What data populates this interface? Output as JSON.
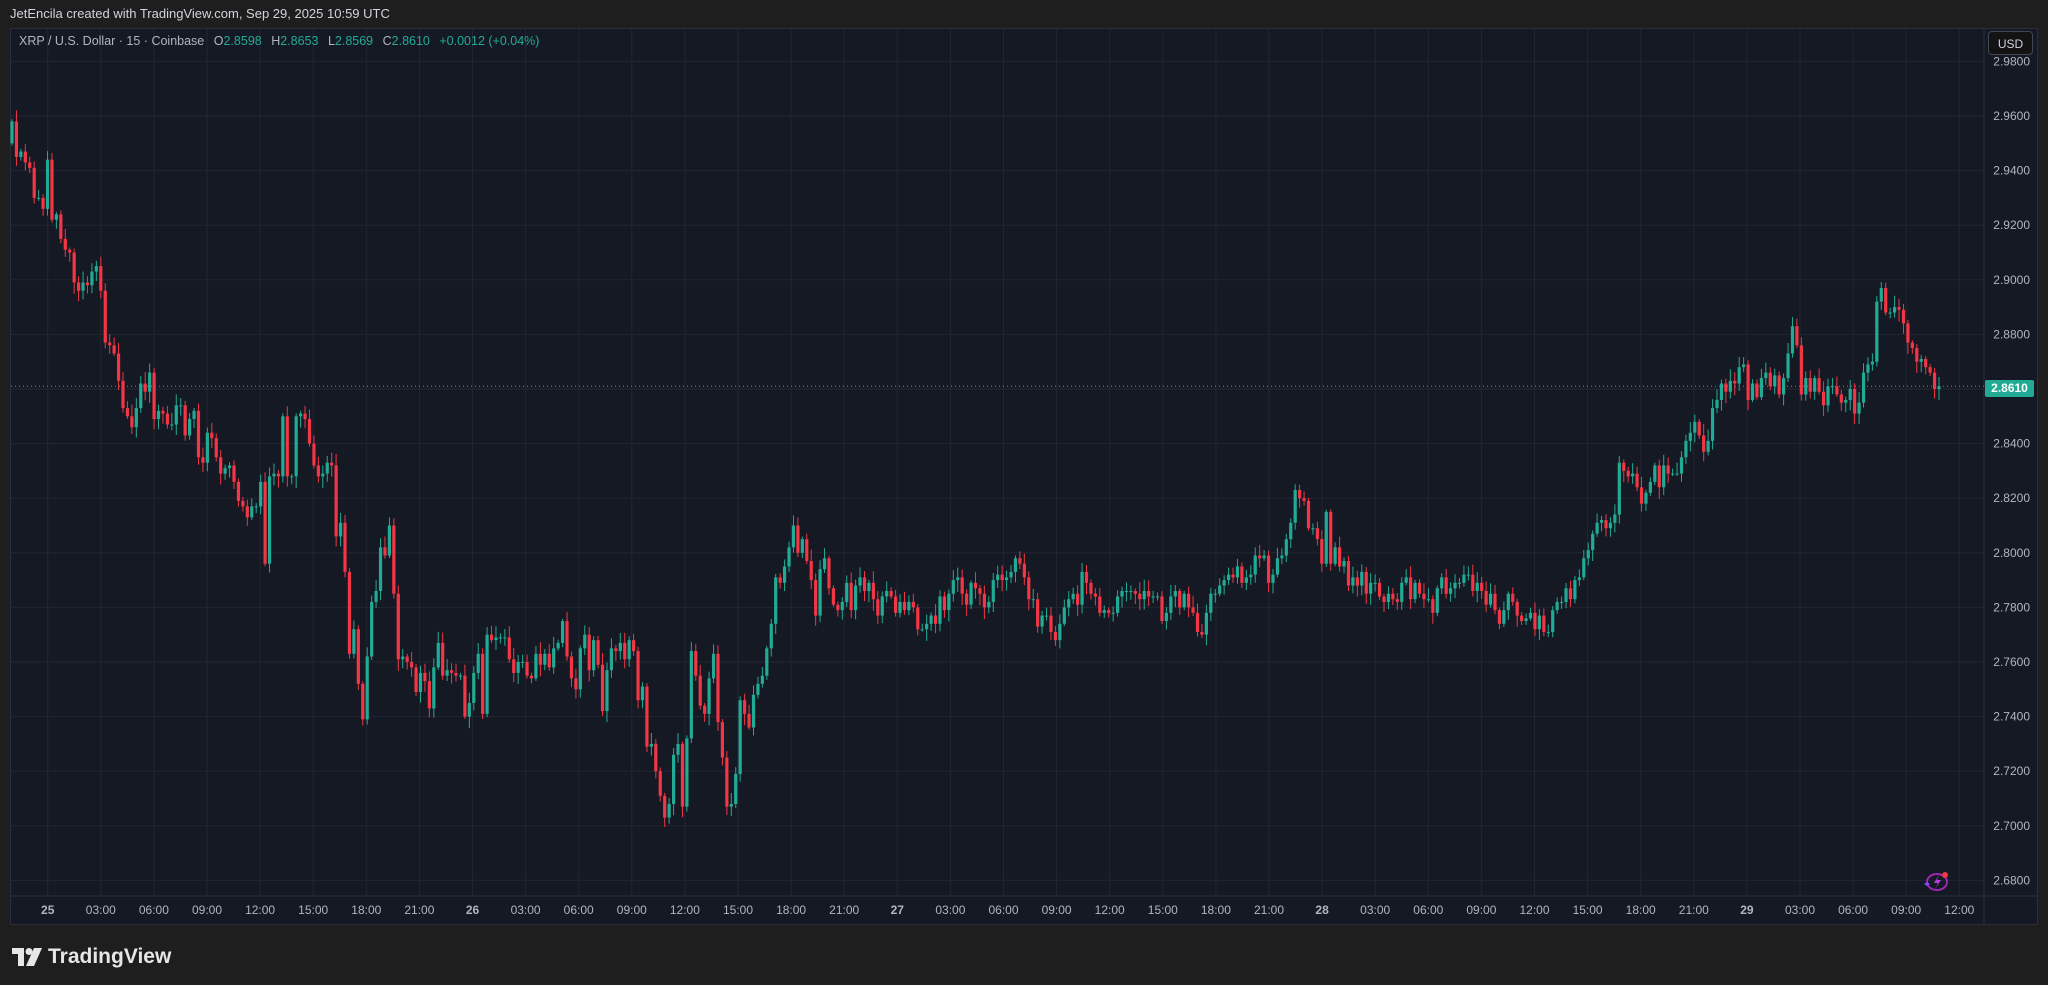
{
  "header": {
    "credit": "JetEncila created with TradingView.com, Sep 29, 2025 10:59 UTC"
  },
  "legend": {
    "symbol": "XRP / U.S. Dollar · 15 · Coinbase",
    "open_label": "O",
    "open": "2.8598",
    "high_label": "H",
    "high": "2.8653",
    "low_label": "L",
    "low": "2.8569",
    "close_label": "C",
    "close": "2.8610",
    "change": "+0.0012 (+0.04%)"
  },
  "currency_button": "USD",
  "current_price": "2.8610",
  "brand": {
    "name": "TradingView",
    "logo_icon": "tradingview-logo-icon"
  },
  "colors": {
    "up": "#22ab94",
    "down": "#f23645",
    "background": "#151924",
    "grid": "#232632",
    "text": "#b2b5be"
  },
  "icons": {
    "bottom_right": "lightning-icon"
  },
  "chart_data": {
    "type": "candlestick",
    "interval": "15",
    "current_price": 2.861,
    "ylim": [
      2.67,
      2.985
    ],
    "y_ticks": [
      "2.9800",
      "2.9600",
      "2.9400",
      "2.9200",
      "2.9000",
      "2.8800",
      "2.8600",
      "2.8400",
      "2.8200",
      "2.8000",
      "2.7800",
      "2.7600",
      "2.7400",
      "2.7200",
      "2.7000",
      "2.6800"
    ],
    "x_ticks": [
      "25",
      "03:00",
      "06:00",
      "09:00",
      "12:00",
      "15:00",
      "18:00",
      "21:00",
      "26",
      "03:00",
      "06:00",
      "09:00",
      "12:00",
      "15:00",
      "18:00",
      "21:00",
      "27",
      "03:00",
      "06:00",
      "09:00",
      "12:00",
      "15:00",
      "18:00",
      "21:00",
      "28",
      "03:00",
      "06:00",
      "09:00",
      "12:00",
      "15:00",
      "18:00",
      "21:00",
      "29",
      "03:00",
      "06:00",
      "09:00",
      "12:00"
    ],
    "grid": true,
    "closes": [
      2.958,
      2.945,
      2.947,
      2.943,
      2.941,
      2.93,
      2.93,
      2.926,
      2.944,
      2.922,
      2.924,
      2.915,
      2.911,
      2.91,
      2.899,
      2.896,
      2.899,
      2.898,
      2.903,
      2.905,
      2.896,
      2.877,
      2.876,
      2.873,
      2.863,
      2.853,
      2.85,
      2.846,
      2.853,
      2.862,
      2.859,
      2.866,
      2.849,
      2.852,
      2.851,
      2.847,
      2.847,
      2.854,
      2.854,
      2.843,
      2.849,
      2.852,
      2.835,
      2.833,
      2.844,
      2.842,
      2.835,
      2.829,
      2.831,
      2.832,
      2.826,
      2.819,
      2.817,
      2.813,
      2.817,
      2.817,
      2.826,
      2.796,
      2.828,
      2.829,
      2.828,
      2.85,
      2.828,
      2.828,
      2.85,
      2.851,
      2.849,
      2.84,
      2.832,
      2.828,
      2.829,
      2.833,
      2.832,
      2.806,
      2.811,
      2.793,
      2.763,
      2.772,
      2.752,
      2.739,
      2.762,
      2.782,
      2.786,
      2.802,
      2.799,
      2.81,
      2.785,
      2.761,
      2.762,
      2.76,
      2.758,
      2.749,
      2.756,
      2.753,
      2.743,
      2.758,
      2.767,
      2.755,
      2.757,
      2.756,
      2.755,
      2.755,
      2.74,
      2.745,
      2.756,
      2.763,
      2.741,
      2.77,
      2.768,
      2.769,
      2.769,
      2.769,
      2.761,
      2.756,
      2.76,
      2.76,
      2.755,
      2.754,
      2.763,
      2.759,
      2.763,
      2.758,
      2.765,
      2.767,
      2.775,
      2.762,
      2.754,
      2.75,
      2.765,
      2.77,
      2.757,
      2.768,
      2.759,
      2.742,
      2.757,
      2.765,
      2.764,
      2.767,
      2.761,
      2.768,
      2.764,
      2.746,
      2.751,
      2.729,
      2.73,
      2.72,
      2.711,
      2.703,
      2.708,
      2.726,
      2.73,
      2.707,
      2.732,
      2.764,
      2.755,
      2.744,
      2.741,
      2.754,
      2.763,
      2.738,
      2.725,
      2.707,
      2.708,
      2.719,
      2.746,
      2.741,
      2.736,
      2.748,
      2.752,
      2.755,
      2.765,
      2.774,
      2.791,
      2.789,
      2.795,
      2.802,
      2.81,
      2.8,
      2.805,
      2.797,
      2.79,
      2.777,
      2.794,
      2.798,
      2.787,
      2.781,
      2.779,
      2.782,
      2.789,
      2.779,
      2.788,
      2.791,
      2.786,
      2.789,
      2.783,
      2.777,
      2.784,
      2.786,
      2.784,
      2.778,
      2.782,
      2.779,
      2.782,
      2.78,
      2.772,
      2.772,
      2.774,
      2.777,
      2.774,
      2.784,
      2.779,
      2.785,
      2.79,
      2.791,
      2.785,
      2.781,
      2.789,
      2.787,
      2.785,
      2.78,
      2.782,
      2.79,
      2.792,
      2.79,
      2.791,
      2.793,
      2.798,
      2.796,
      2.791,
      2.783,
      2.783,
      2.773,
      2.777,
      2.777,
      2.771,
      2.768,
      2.774,
      2.78,
      2.783,
      2.785,
      2.781,
      2.793,
      2.789,
      2.785,
      2.784,
      2.778,
      2.779,
      2.778,
      2.778,
      2.784,
      2.786,
      2.786,
      2.786,
      2.785,
      2.783,
      2.786,
      2.784,
      2.784,
      2.784,
      2.775,
      2.778,
      2.784,
      2.786,
      2.78,
      2.785,
      2.78,
      2.778,
      2.771,
      2.77,
      2.778,
      2.785,
      2.785,
      2.788,
      2.79,
      2.792,
      2.791,
      2.795,
      2.789,
      2.791,
      2.792,
      2.799,
      2.798,
      2.799,
      2.789,
      2.792,
      2.798,
      2.799,
      2.805,
      2.811,
      2.823,
      2.82,
      2.819,
      2.809,
      2.809,
      2.805,
      2.796,
      2.815,
      2.796,
      2.802,
      2.795,
      2.797,
      2.788,
      2.791,
      2.788,
      2.793,
      2.785,
      2.789,
      2.789,
      2.784,
      2.782,
      2.785,
      2.783,
      2.782,
      2.789,
      2.791,
      2.783,
      2.789,
      2.785,
      2.783,
      2.783,
      2.778,
      2.787,
      2.791,
      2.785,
      2.787,
      2.789,
      2.789,
      2.792,
      2.792,
      2.786,
      2.789,
      2.786,
      2.781,
      2.785,
      2.779,
      2.774,
      2.779,
      2.785,
      2.782,
      2.777,
      2.775,
      2.776,
      2.778,
      2.772,
      2.777,
      2.771,
      2.771,
      2.779,
      2.782,
      2.782,
      2.787,
      2.783,
      2.79,
      2.791,
      2.798,
      2.801,
      2.807,
      2.811,
      2.812,
      2.809,
      2.811,
      2.814,
      2.833,
      2.83,
      2.828,
      2.829,
      2.824,
      2.818,
      2.822,
      2.826,
      2.832,
      2.824,
      2.832,
      2.829,
      2.829,
      2.829,
      2.835,
      2.841,
      2.844,
      2.848,
      2.843,
      2.837,
      2.841,
      2.853,
      2.856,
      2.862,
      2.859,
      2.863,
      2.862,
      2.868,
      2.869,
      2.856,
      2.862,
      2.857,
      2.864,
      2.866,
      2.861,
      2.865,
      2.858,
      2.864,
      2.873,
      2.883,
      2.876,
      2.858,
      2.864,
      2.859,
      2.864,
      2.859,
      2.854,
      2.861,
      2.861,
      2.858,
      2.855,
      2.856,
      2.86,
      2.851,
      2.855,
      2.866,
      2.869,
      2.87,
      2.892,
      2.897,
      2.888,
      2.888,
      2.89,
      2.889,
      2.884,
      2.877,
      2.875,
      2.87,
      2.871,
      2.868,
      2.866,
      2.86,
      2.861
    ]
  }
}
